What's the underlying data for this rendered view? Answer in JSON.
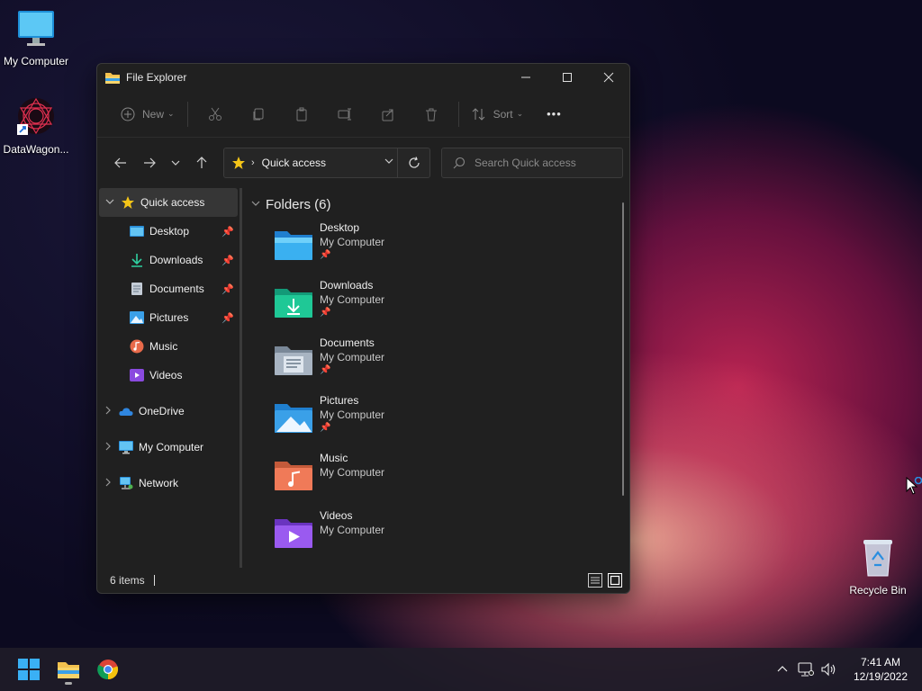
{
  "desktop": {
    "icons": [
      {
        "label": "My Computer",
        "icon": "monitor-icon"
      },
      {
        "label": "DataWagon...",
        "icon": "datawagon-icon"
      },
      {
        "label": "Recycle Bin",
        "icon": "recycle-bin-icon"
      }
    ]
  },
  "window": {
    "title": "File Explorer",
    "controls": {
      "minimize": "—",
      "maximize": "☐",
      "close": "✕"
    }
  },
  "toolbar": {
    "new_label": "New",
    "sort_label": "Sort",
    "more_label": "•••"
  },
  "navbar": {
    "address": "Quick access",
    "search_placeholder": "Search Quick access"
  },
  "sidebar": {
    "items": [
      {
        "label": "Quick access",
        "icon": "star-icon"
      },
      {
        "label": "Desktop",
        "icon": "desktop-folder-icon"
      },
      {
        "label": "Downloads",
        "icon": "download-icon"
      },
      {
        "label": "Documents",
        "icon": "document-icon"
      },
      {
        "label": "Pictures",
        "icon": "picture-icon"
      },
      {
        "label": "Music",
        "icon": "music-icon"
      },
      {
        "label": "Videos",
        "icon": "video-icon"
      },
      {
        "label": "OneDrive",
        "icon": "cloud-icon"
      },
      {
        "label": "My Computer",
        "icon": "monitor-icon"
      },
      {
        "label": "Network",
        "icon": "network-icon"
      }
    ]
  },
  "content": {
    "group_title": "Folders (6)",
    "folders": [
      {
        "name": "Desktop",
        "location": "My Computer",
        "pinned": true
      },
      {
        "name": "Downloads",
        "location": "My Computer",
        "pinned": true
      },
      {
        "name": "Documents",
        "location": "My Computer",
        "pinned": true
      },
      {
        "name": "Pictures",
        "location": "My Computer",
        "pinned": true
      },
      {
        "name": "Music",
        "location": "My Computer",
        "pinned": false
      },
      {
        "name": "Videos",
        "location": "My Computer",
        "pinned": false
      }
    ]
  },
  "status": {
    "item_count": "6 items"
  },
  "taskbar": {
    "time": "7:41 AM",
    "date": "12/19/2022"
  },
  "colors": {
    "window_bg": "#202020",
    "accent_blue": "#3aa0e8",
    "folder_yellow": "#f2c14e"
  }
}
